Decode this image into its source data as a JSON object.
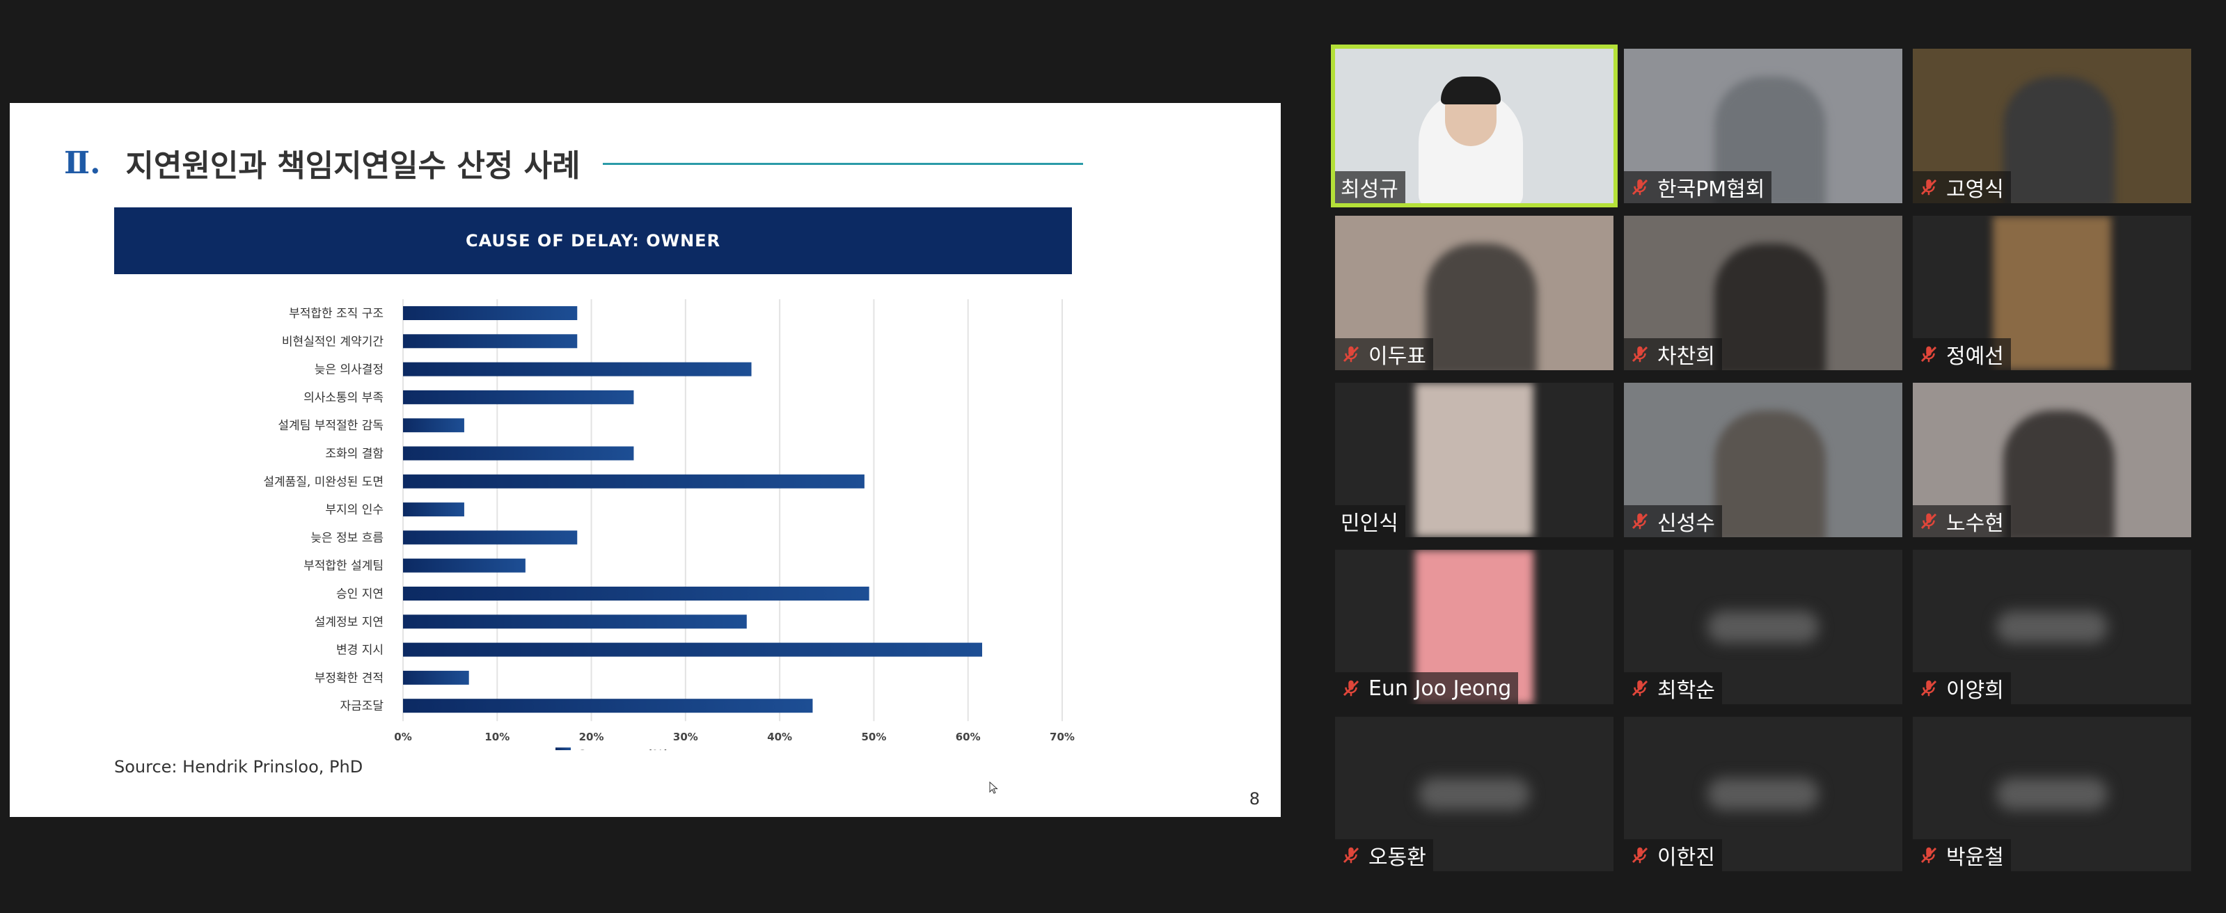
{
  "slide": {
    "section_number": "Ⅱ.",
    "title": "지연원인과 책임지연일수 산정 사례",
    "chart_banner": "CAUSE OF DELAY: OWNER",
    "source": "Source: Hendrik Prinsloo, PhD",
    "page_number": "8"
  },
  "chart_data": {
    "type": "bar",
    "orientation": "horizontal",
    "title": "CAUSE OF DELAY: OWNER",
    "categories": [
      "부적합한 조직 구조",
      "비현실적인 계약기간",
      "늦은 의사결정",
      "의사소통의 부족",
      "설계팀 부적절한 감독",
      "조화의 결함",
      "설계품질, 미완성된 도면",
      "부지의 인수",
      "늦은 정보 흐름",
      "부적합한 설계팀",
      "승인 지연",
      "설계정보 지연",
      "변경 지시",
      "부정확한 견적",
      "자금조달"
    ],
    "values": [
      18.5,
      18.5,
      37,
      24.5,
      6.5,
      24.5,
      49,
      6.5,
      18.5,
      13,
      49.5,
      36.5,
      61.5,
      7,
      43.5
    ],
    "xlim": [
      0,
      70
    ],
    "xticks": [
      "0%",
      "10%",
      "20%",
      "30%",
      "40%",
      "50%",
      "60%",
      "70%"
    ],
    "legend": "Occurance (%)",
    "legend_position": "bottom",
    "grid": "vertical",
    "bar_color": "#1d4e94"
  },
  "participants": [
    {
      "name": "최성규",
      "muted": false,
      "active": true,
      "bg": "#d9dde0",
      "video": "#b8bec5"
    },
    {
      "name": "한국PM협회",
      "muted": true,
      "active": false,
      "bg": "#8f9196",
      "video": "#6f7378"
    },
    {
      "name": "고영식",
      "muted": true,
      "active": false,
      "bg": "#5a4a30",
      "video": "#3a3a3a"
    },
    {
      "name": "이두표",
      "muted": true,
      "active": false,
      "bg": "#a6978d",
      "video": "#4b4642"
    },
    {
      "name": "차찬희",
      "muted": true,
      "active": false,
      "bg": "#6f6a66",
      "video": "#2f2c2a"
    },
    {
      "name": "정예선",
      "muted": true,
      "active": false,
      "bg": "#262626",
      "video": "#8a6a45"
    },
    {
      "name": "민인식",
      "muted": false,
      "active": false,
      "bg": "#262626",
      "video": "#c6b8b0"
    },
    {
      "name": "신성수",
      "muted": true,
      "active": false,
      "bg": "#7a7d80",
      "video": "#5a5550"
    },
    {
      "name": "노수현",
      "muted": true,
      "active": false,
      "bg": "#9a9390",
      "video": "#3e3a38"
    },
    {
      "name": "Eun Joo Jeong",
      "muted": true,
      "active": false,
      "bg": "#262626",
      "video": "#e8969a"
    },
    {
      "name": "최학순",
      "muted": true,
      "active": false,
      "bg": "#262626",
      "video": ""
    },
    {
      "name": "이양희",
      "muted": true,
      "active": false,
      "bg": "#262626",
      "video": ""
    },
    {
      "name": "오동환",
      "muted": true,
      "active": false,
      "bg": "#262626",
      "video": ""
    },
    {
      "name": "이한진",
      "muted": true,
      "active": false,
      "bg": "#262626",
      "video": ""
    },
    {
      "name": "박윤철",
      "muted": true,
      "active": false,
      "bg": "#262626",
      "video": ""
    }
  ]
}
